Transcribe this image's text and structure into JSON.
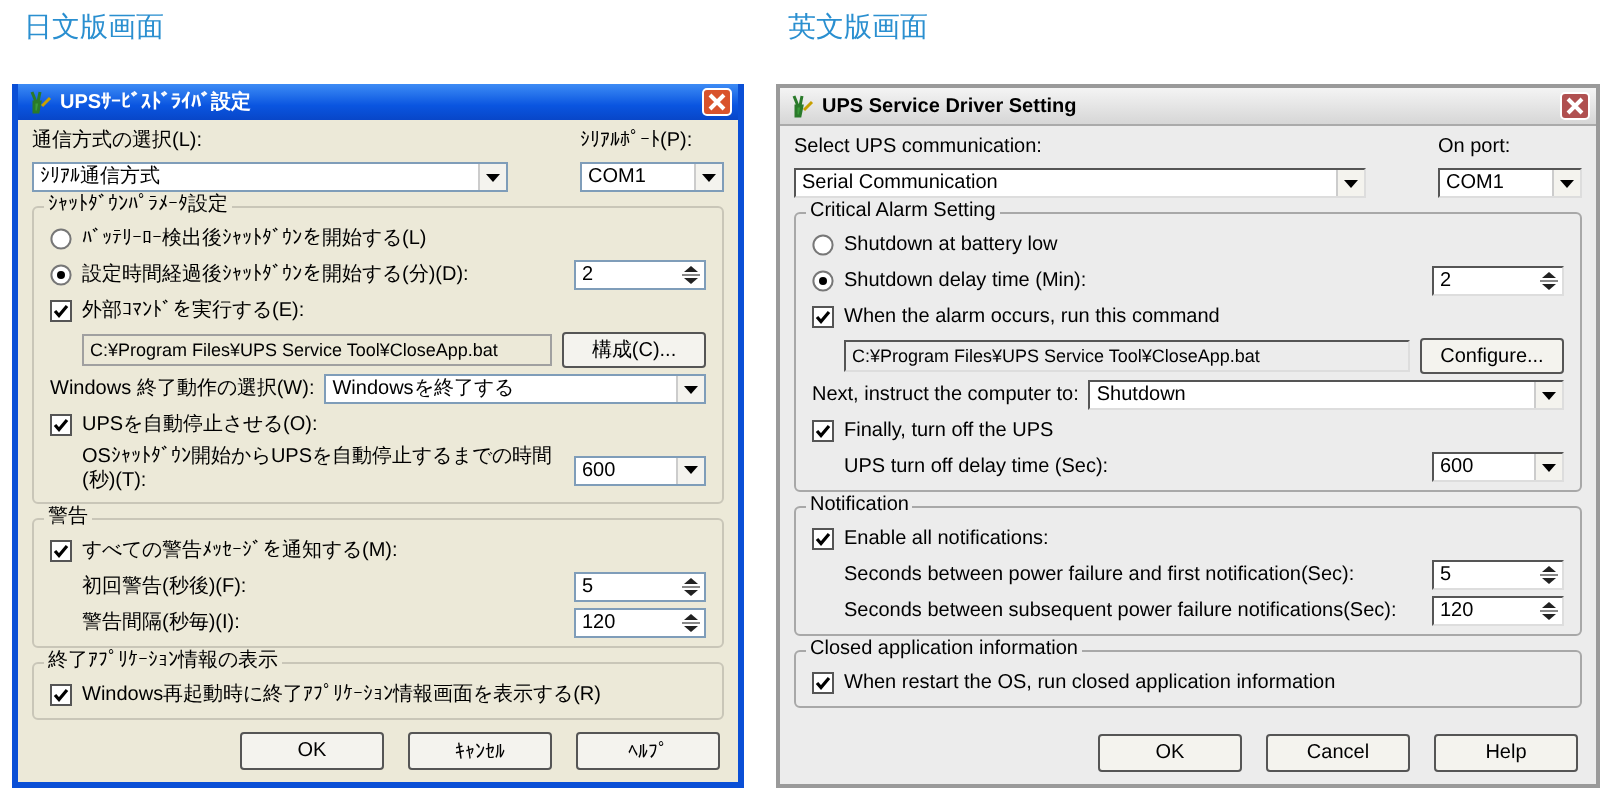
{
  "panels": [
    {
      "heading": "日文版画面",
      "dialog": {
        "kind": "xp",
        "title": "UPSｻｰﾋﾞｽﾄﾞﾗｲﾊﾞ設定",
        "comm_label": "通信方式の選択(L):",
        "comm_value": "ｼﾘｱﾙ通信方式",
        "port_label": "ｼﾘｱﾙﾎﾟｰﾄ(P):",
        "port_value": "COM1",
        "groups": [
          {
            "title": "ｼｬｯﾄﾀﾞｳﾝﾊﾟﾗﾒｰﾀ設定",
            "rows": [
              {
                "kind": "radio",
                "label": "ﾊﾞｯﾃﾘｰﾛｰ検出後ｼｬｯﾄﾀﾞｳﾝを開始する(L)",
                "selected": false
              },
              {
                "kind": "radio",
                "label": "設定時間経過後ｼｬｯﾄﾀﾞｳﾝを開始する(分)(D):",
                "selected": true,
                "value": "2"
              },
              {
                "kind": "check",
                "label": "外部ｺﾏﾝﾄﾞを実行する(E):",
                "checked": true
              },
              {
                "kind": "command",
                "value": "C:¥Program Files¥UPS Service Tool¥CloseApp.bat",
                "button": "構成(C)..."
              },
              {
                "kind": "combo",
                "label": "Windows 終了動作の選択(W):",
                "value": "Windowsを終了する"
              },
              {
                "kind": "check",
                "label": "UPSを自動停止させる(O):",
                "checked": true
              },
              {
                "kind": "combo_small",
                "label": "OSｼｬｯﾄﾀﾞｳﾝ開始からUPSを自動停止するまでの時間(秒)(T):",
                "value": "600"
              }
            ]
          },
          {
            "title": "警告",
            "rows": [
              {
                "kind": "check",
                "label": "すべての警告ﾒｯｾｰｼﾞを通知する(M):",
                "checked": true
              },
              {
                "kind": "spin",
                "label": "初回警告(秒後)(F):",
                "value": "5"
              },
              {
                "kind": "spin",
                "label": "警告間隔(秒毎)(I):",
                "value": "120"
              }
            ]
          },
          {
            "title": "終了ｱﾌﾟﾘｹｰｼｮﾝ情報の表示",
            "rows": [
              {
                "kind": "check",
                "label": "Windows再起動時に終了ｱﾌﾟﾘｹｰｼｮﾝ情報画面を表示する(R)",
                "checked": true
              }
            ]
          }
        ],
        "buttons": [
          "OK",
          "ｷｬﾝｾﾙ",
          "ﾍﾙﾌﾟ"
        ]
      }
    },
    {
      "heading": "英文版画面",
      "dialog": {
        "kind": "classic",
        "title": "UPS Service Driver Setting",
        "comm_label": "Select UPS communication:",
        "comm_value": "Serial Communication",
        "port_label": "On port:",
        "port_value": "COM1",
        "groups": [
          {
            "title": "Critical Alarm Setting",
            "rows": [
              {
                "kind": "radio",
                "label": "Shutdown at battery low",
                "selected": false
              },
              {
                "kind": "radio",
                "label": "Shutdown delay time (Min):",
                "selected": true,
                "value": "2"
              },
              {
                "kind": "check",
                "label": "When the alarm occurs, run this command",
                "checked": true
              },
              {
                "kind": "command",
                "value": "C:¥Program Files¥UPS Service Tool¥CloseApp.bat",
                "button": "Configure..."
              },
              {
                "kind": "combo",
                "label": "Next, instruct the computer to:",
                "value": "Shutdown"
              },
              {
                "kind": "check",
                "label": "Finally, turn off the UPS",
                "checked": true
              },
              {
                "kind": "combo_small",
                "label": "UPS turn off delay time (Sec):",
                "value": "600"
              }
            ]
          },
          {
            "title": "Notification",
            "rows": [
              {
                "kind": "check",
                "label": "Enable all notifications:",
                "checked": true
              },
              {
                "kind": "spin",
                "label": "Seconds between power failure and first notification(Sec):",
                "value": "5"
              },
              {
                "kind": "spin",
                "label": "Seconds between subsequent power failure notifications(Sec):",
                "value": "120"
              }
            ]
          },
          {
            "title": "Closed application information",
            "rows": [
              {
                "kind": "check",
                "label": "When restart the OS, run closed application information",
                "checked": true
              }
            ]
          }
        ],
        "buttons": [
          "OK",
          "Cancel",
          "Help"
        ]
      }
    }
  ]
}
